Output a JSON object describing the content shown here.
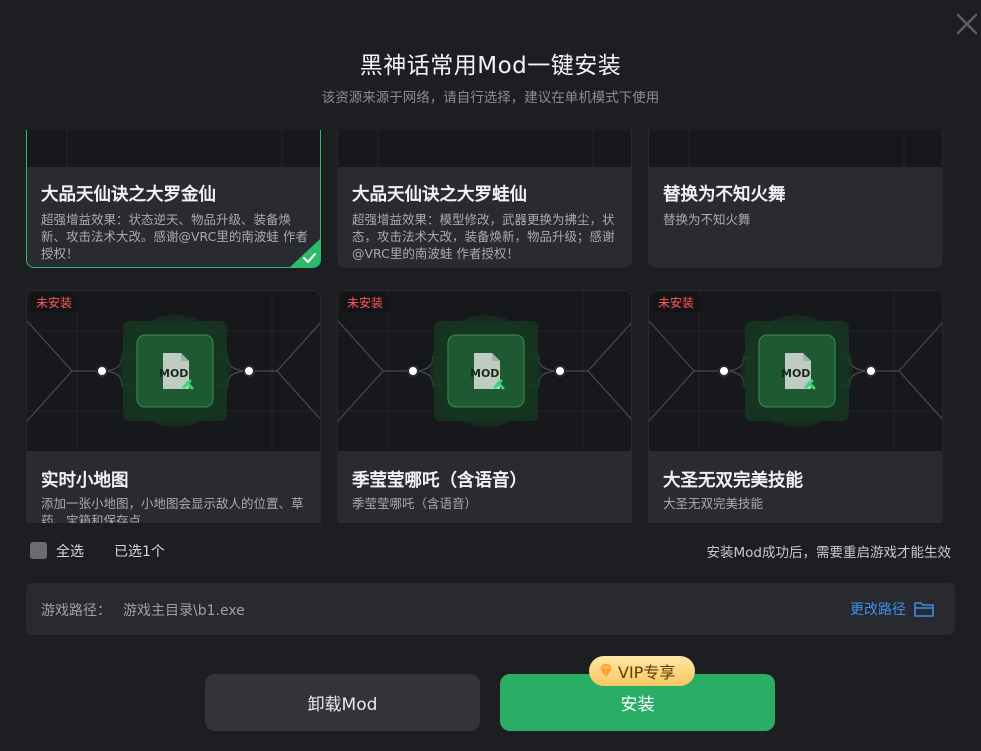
{
  "dialog": {
    "title": "黑神话常用Mod一键安装",
    "subtitle": "该资源来源于网络，请自行选择，建议在单机模式下使用"
  },
  "icons": {
    "close": "close-icon",
    "check": "check-icon",
    "mod_file": "mod-file-icon",
    "folder": "folder-icon",
    "vip": "diamond-icon"
  },
  "mods": [
    {
      "title": "大品天仙诀之大罗金仙",
      "description": "超强增益效果：状态逆天、物品升级、装备焕新、攻击法术大改。感谢@VRC里的南波蛙 作者授权！",
      "selected": true
    },
    {
      "title": "大品天仙诀之大罗蛙仙",
      "description": "超强增益效果：模型修改，武器更换为拂尘，状态，攻击法术大改，装备焕新，物品升级；感谢@VRC里的南波蛙 作者授权！",
      "selected": false
    },
    {
      "title": "替换为不知火舞",
      "description": "替换为不知火舞",
      "selected": false
    },
    {
      "title": "实时小地图",
      "description": "添加一张小地图，小地图会显示敌人的位置、草药、宝箱和保存点",
      "badge": "未安装",
      "selected": false
    },
    {
      "title": "季莹莹哪吒（含语音）",
      "description": "季莹莹哪吒（含语音）",
      "badge": "未安装",
      "selected": false
    },
    {
      "title": "大圣无双完美技能",
      "description": "大圣无双完美技能",
      "badge": "未安装",
      "selected": false
    }
  ],
  "footer": {
    "select_all": "全选",
    "selected_count": "已选1个",
    "note": "安装Mod成功后，需要重启游戏才能生效"
  },
  "path": {
    "label": "游戏路径：",
    "value": "游戏主目录\\b1.exe",
    "change_label": "更改路径"
  },
  "buttons": {
    "uninstall": "卸载Mod",
    "install": "安装",
    "vip_badge": "VIP专享"
  },
  "colors": {
    "background": "#1d1e22",
    "card": "#2a2b30",
    "accent_green": "#2aae66",
    "selected_border": "#2fb96a",
    "link_blue": "#3f8ff0",
    "badge_red": "#ff5a5a",
    "vip_gold": "#f7c760"
  }
}
